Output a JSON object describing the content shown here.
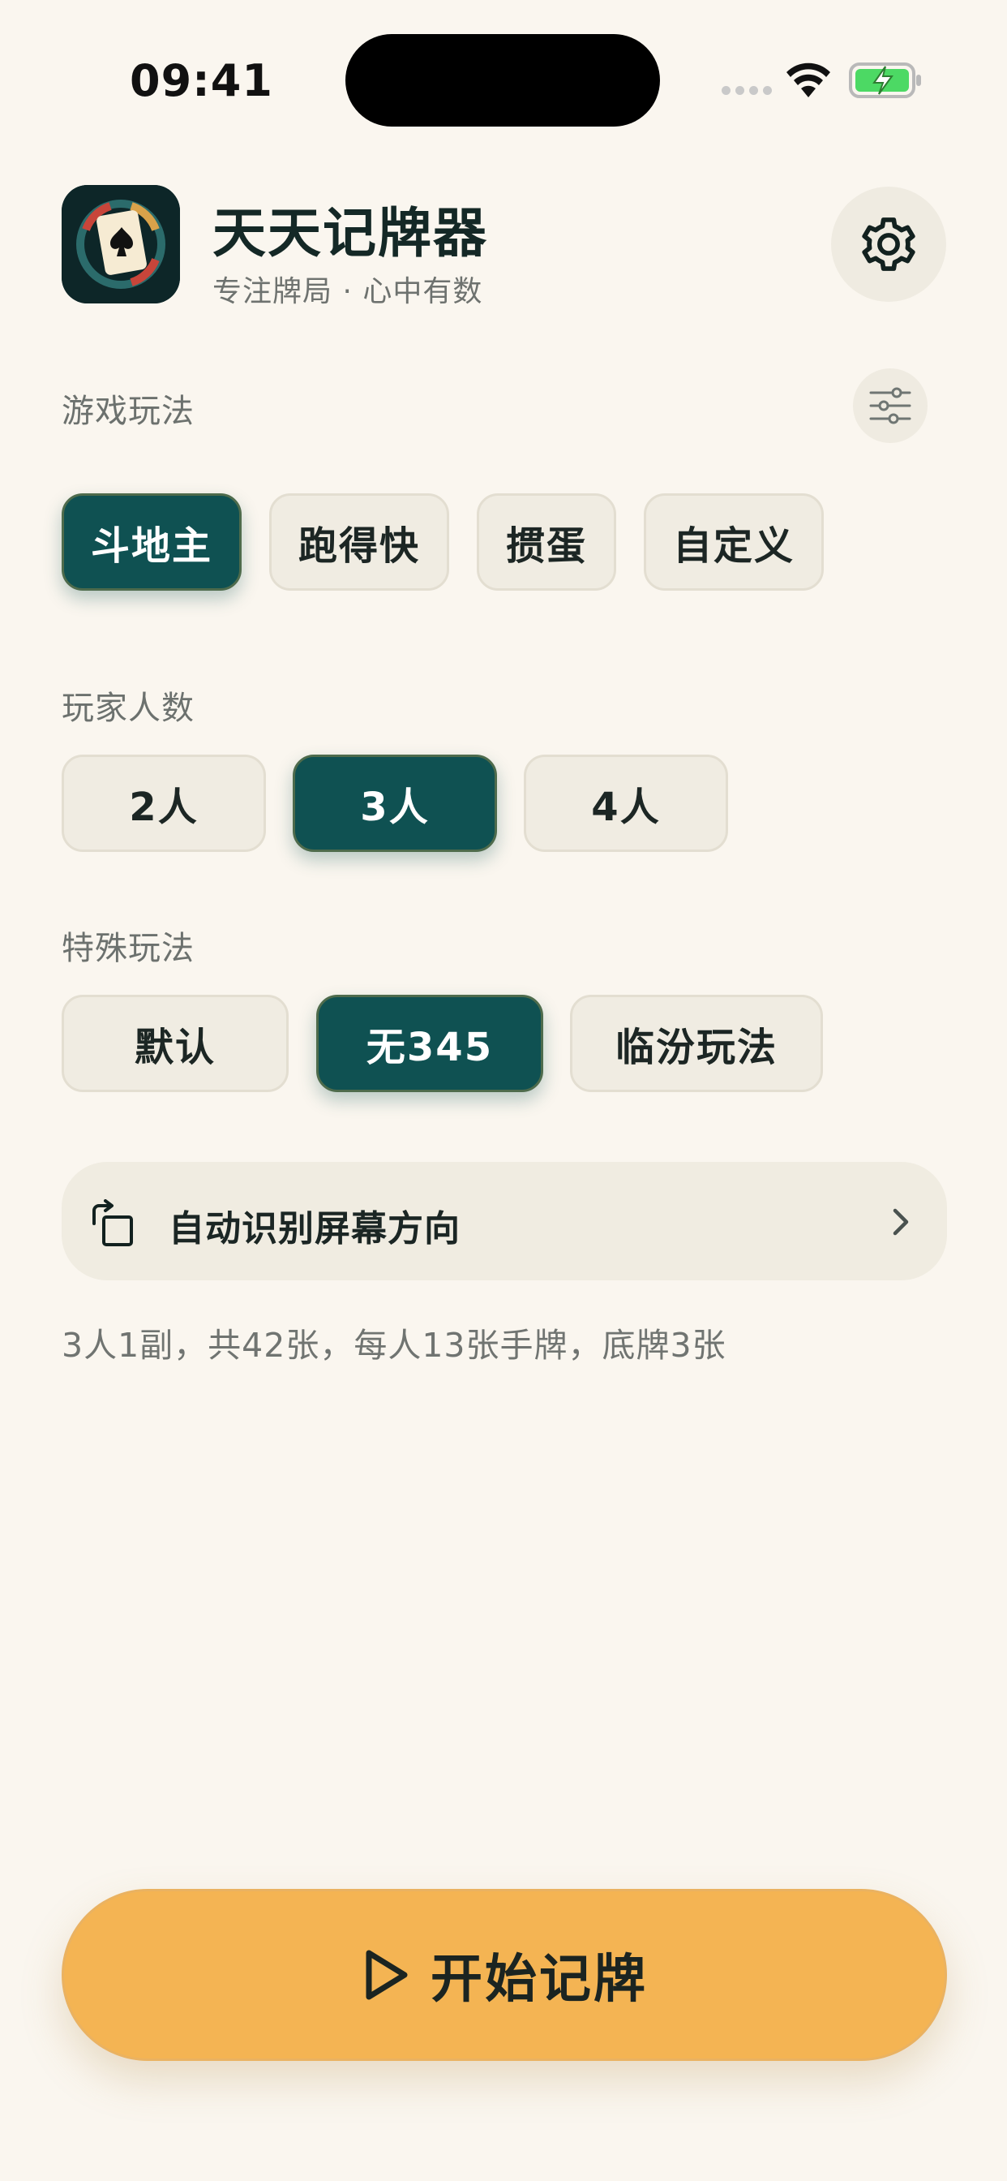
{
  "status_bar": {
    "time": "09:41"
  },
  "header": {
    "title": "天天记牌器",
    "subtitle": "专注牌局 · 心中有数",
    "app_icon": "spade-card-icon",
    "settings_icon": "gear-icon"
  },
  "game_mode": {
    "label": "游戏玩法",
    "filter_icon": "sliders-icon",
    "options": [
      "斗地主",
      "跑得快",
      "掼蛋",
      "自定义"
    ],
    "selected": "斗地主"
  },
  "players": {
    "label": "玩家人数",
    "options": [
      "2人",
      "3人",
      "4人"
    ],
    "selected": "3人"
  },
  "special": {
    "label": "特殊玩法",
    "options": [
      "默认",
      "无345",
      "临汾玩法"
    ],
    "selected": "无345"
  },
  "orientation": {
    "label": "自动识别屏幕方向",
    "icon": "rotate-screen-icon",
    "chevron_icon": "chevron-right-icon"
  },
  "summary": "3人1副，共42张，每人13张手牌，底牌3张",
  "start_button": {
    "label": "开始记牌",
    "icon": "play-icon"
  },
  "colors": {
    "background": "#FAF6EF",
    "accent": "#0F5152",
    "chip": "#F0ECE2",
    "start": "#F4B453"
  }
}
